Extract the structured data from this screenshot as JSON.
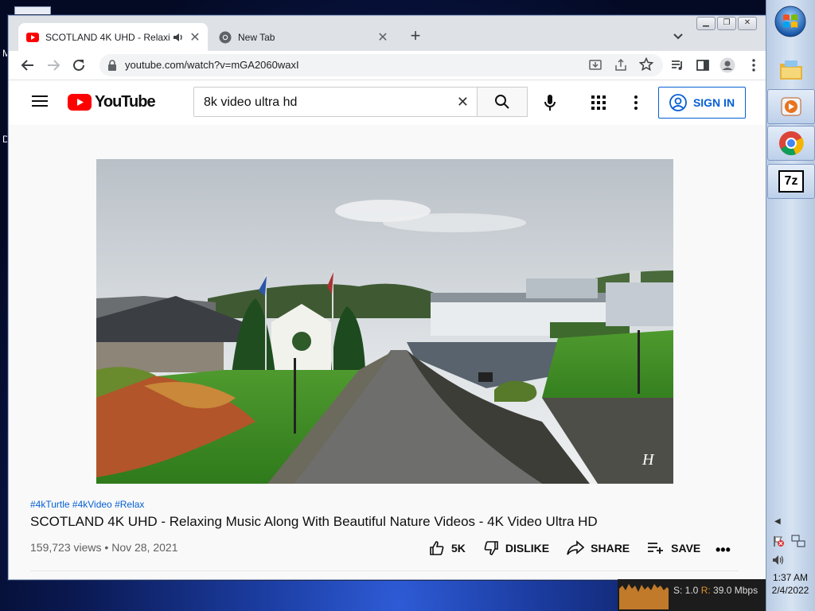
{
  "desktop": {
    "left_labels": [
      "M",
      "D"
    ]
  },
  "browser": {
    "tabs": [
      {
        "title": "SCOTLAND 4K UHD - Relaxi",
        "active": true,
        "favicon": "youtube-icon",
        "audio": true
      },
      {
        "title": "New Tab",
        "active": false,
        "favicon": "chrome-icon"
      }
    ],
    "new_tab": "+",
    "address": "youtube.com/watch?v=mGA2060waxI"
  },
  "youtube": {
    "logo_text": "YouTube",
    "search_query": "8k video ultra hd",
    "signin_label": "SIGN IN",
    "video": {
      "hashtags": "#4kTurtle #4kVideo #Relax",
      "title": "SCOTLAND 4K UHD - Relaxing Music Along With Beautiful Nature Videos - 4K Video Ultra HD",
      "views": "159,723 views",
      "separator": "•",
      "date": "Nov 28, 2021",
      "watermark": "H"
    },
    "actions": {
      "like_count": "5K",
      "dislike": "DISLIKE",
      "share": "SHARE",
      "save": "SAVE",
      "more": "•••"
    }
  },
  "taskbar": {
    "clock_time": "1:37 AM",
    "clock_date": "2/4/2022",
    "app_icons": [
      "windows-orb-icon",
      "explorer-icon",
      "media-player-icon",
      "chrome-icon",
      "7zip-icon"
    ],
    "seven_zip_label": "7z"
  },
  "net_monitor": {
    "text_s": "S: 1.0",
    "text_r_label": "R:",
    "text_r_value": "39.0 Mbps"
  },
  "colors": {
    "youtube_red": "#ff0000",
    "link_blue": "#065fd4",
    "tab_bar": "#dee1e6"
  }
}
